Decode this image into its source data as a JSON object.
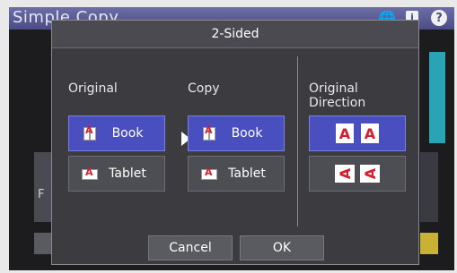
{
  "app": {
    "title": "Simple Copy",
    "icons": [
      "globe-icon",
      "info-icon",
      "help-icon"
    ],
    "info_glyph": "i",
    "help_glyph": "?"
  },
  "background": {
    "partial_label": "F"
  },
  "dialog": {
    "title": "2-Sided",
    "sections": {
      "original": {
        "title": "Original",
        "options": [
          {
            "label": "Book",
            "icon": "book-icon",
            "selected": true
          },
          {
            "label": "Tablet",
            "icon": "tablet-icon",
            "selected": false
          }
        ]
      },
      "copy": {
        "title": "Copy",
        "options": [
          {
            "label": "Book",
            "icon": "book-icon",
            "selected": true
          },
          {
            "label": "Tablet",
            "icon": "tablet-icon",
            "selected": false
          }
        ]
      },
      "direction": {
        "title_line1": "Original",
        "title_line2": "Direction",
        "options": [
          {
            "icon": "upright-orientation-icon",
            "selected": true
          },
          {
            "icon": "rotated-orientation-icon",
            "selected": false
          }
        ],
        "glyph": "A"
      }
    },
    "buttons": {
      "cancel": "Cancel",
      "ok": "OK"
    }
  },
  "colors": {
    "header_gradient_top": "#6e6ea6",
    "selected": "#4a4fc0",
    "dialog_bg": "#3b3b40",
    "accent_red": "#d81c2c"
  }
}
